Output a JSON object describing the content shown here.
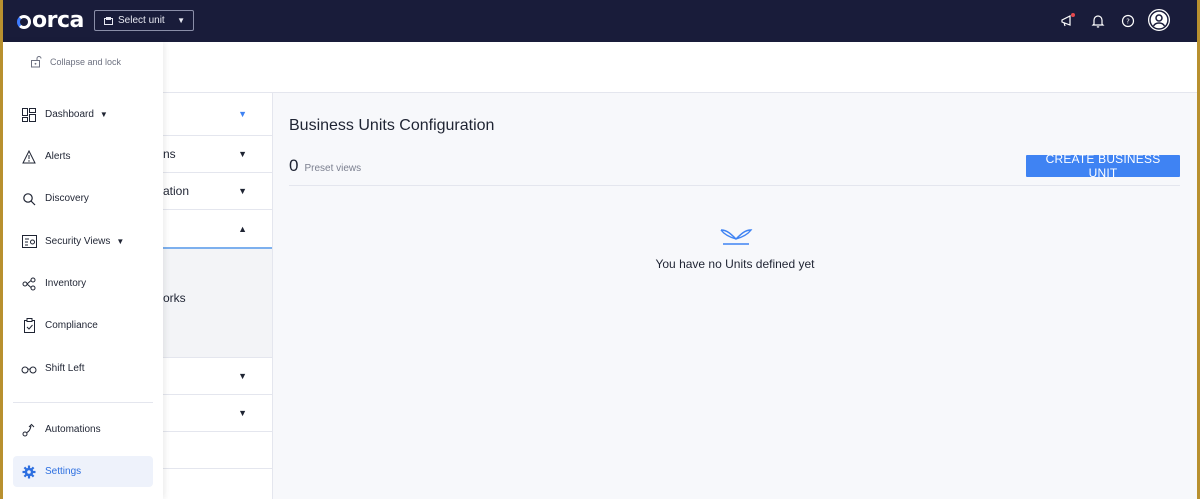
{
  "topbar": {
    "logo": "orca",
    "unit_select": "Select unit"
  },
  "sidebar": {
    "collapse_label": "Collapse and lock",
    "items": [
      {
        "label": "Dashboard",
        "icon": "dashboard-icon"
      },
      {
        "label": "Alerts",
        "icon": "alert-triangle-icon"
      },
      {
        "label": "Discovery",
        "icon": "search-icon"
      },
      {
        "label": "Security Views",
        "icon": "security-views-icon"
      },
      {
        "label": "Inventory",
        "icon": "inventory-icon"
      },
      {
        "label": "Compliance",
        "icon": "clipboard-check-icon"
      },
      {
        "label": "Shift Left",
        "icon": "glasses-icon"
      },
      {
        "label": "Automations",
        "icon": "automations-icon"
      },
      {
        "label": "Settings",
        "icon": "gear-icon"
      }
    ]
  },
  "subnav": {
    "rows": [
      {
        "label": ""
      },
      {
        "label": "ns"
      },
      {
        "label": "ation"
      },
      {
        "label": ""
      },
      {
        "label": "orks"
      },
      {
        "label": ""
      },
      {
        "label": ""
      },
      {
        "label": ""
      }
    ]
  },
  "main": {
    "title": "Business Units Configuration",
    "preset_count": "0",
    "preset_label": "Preset views",
    "create_button": "CREATE BUSINESS UNIT",
    "empty_text": "You have no Units defined yet"
  },
  "colors": {
    "topbar": "#191c3a",
    "accent": "#3f83f3",
    "active_text": "#2d6fe0"
  }
}
